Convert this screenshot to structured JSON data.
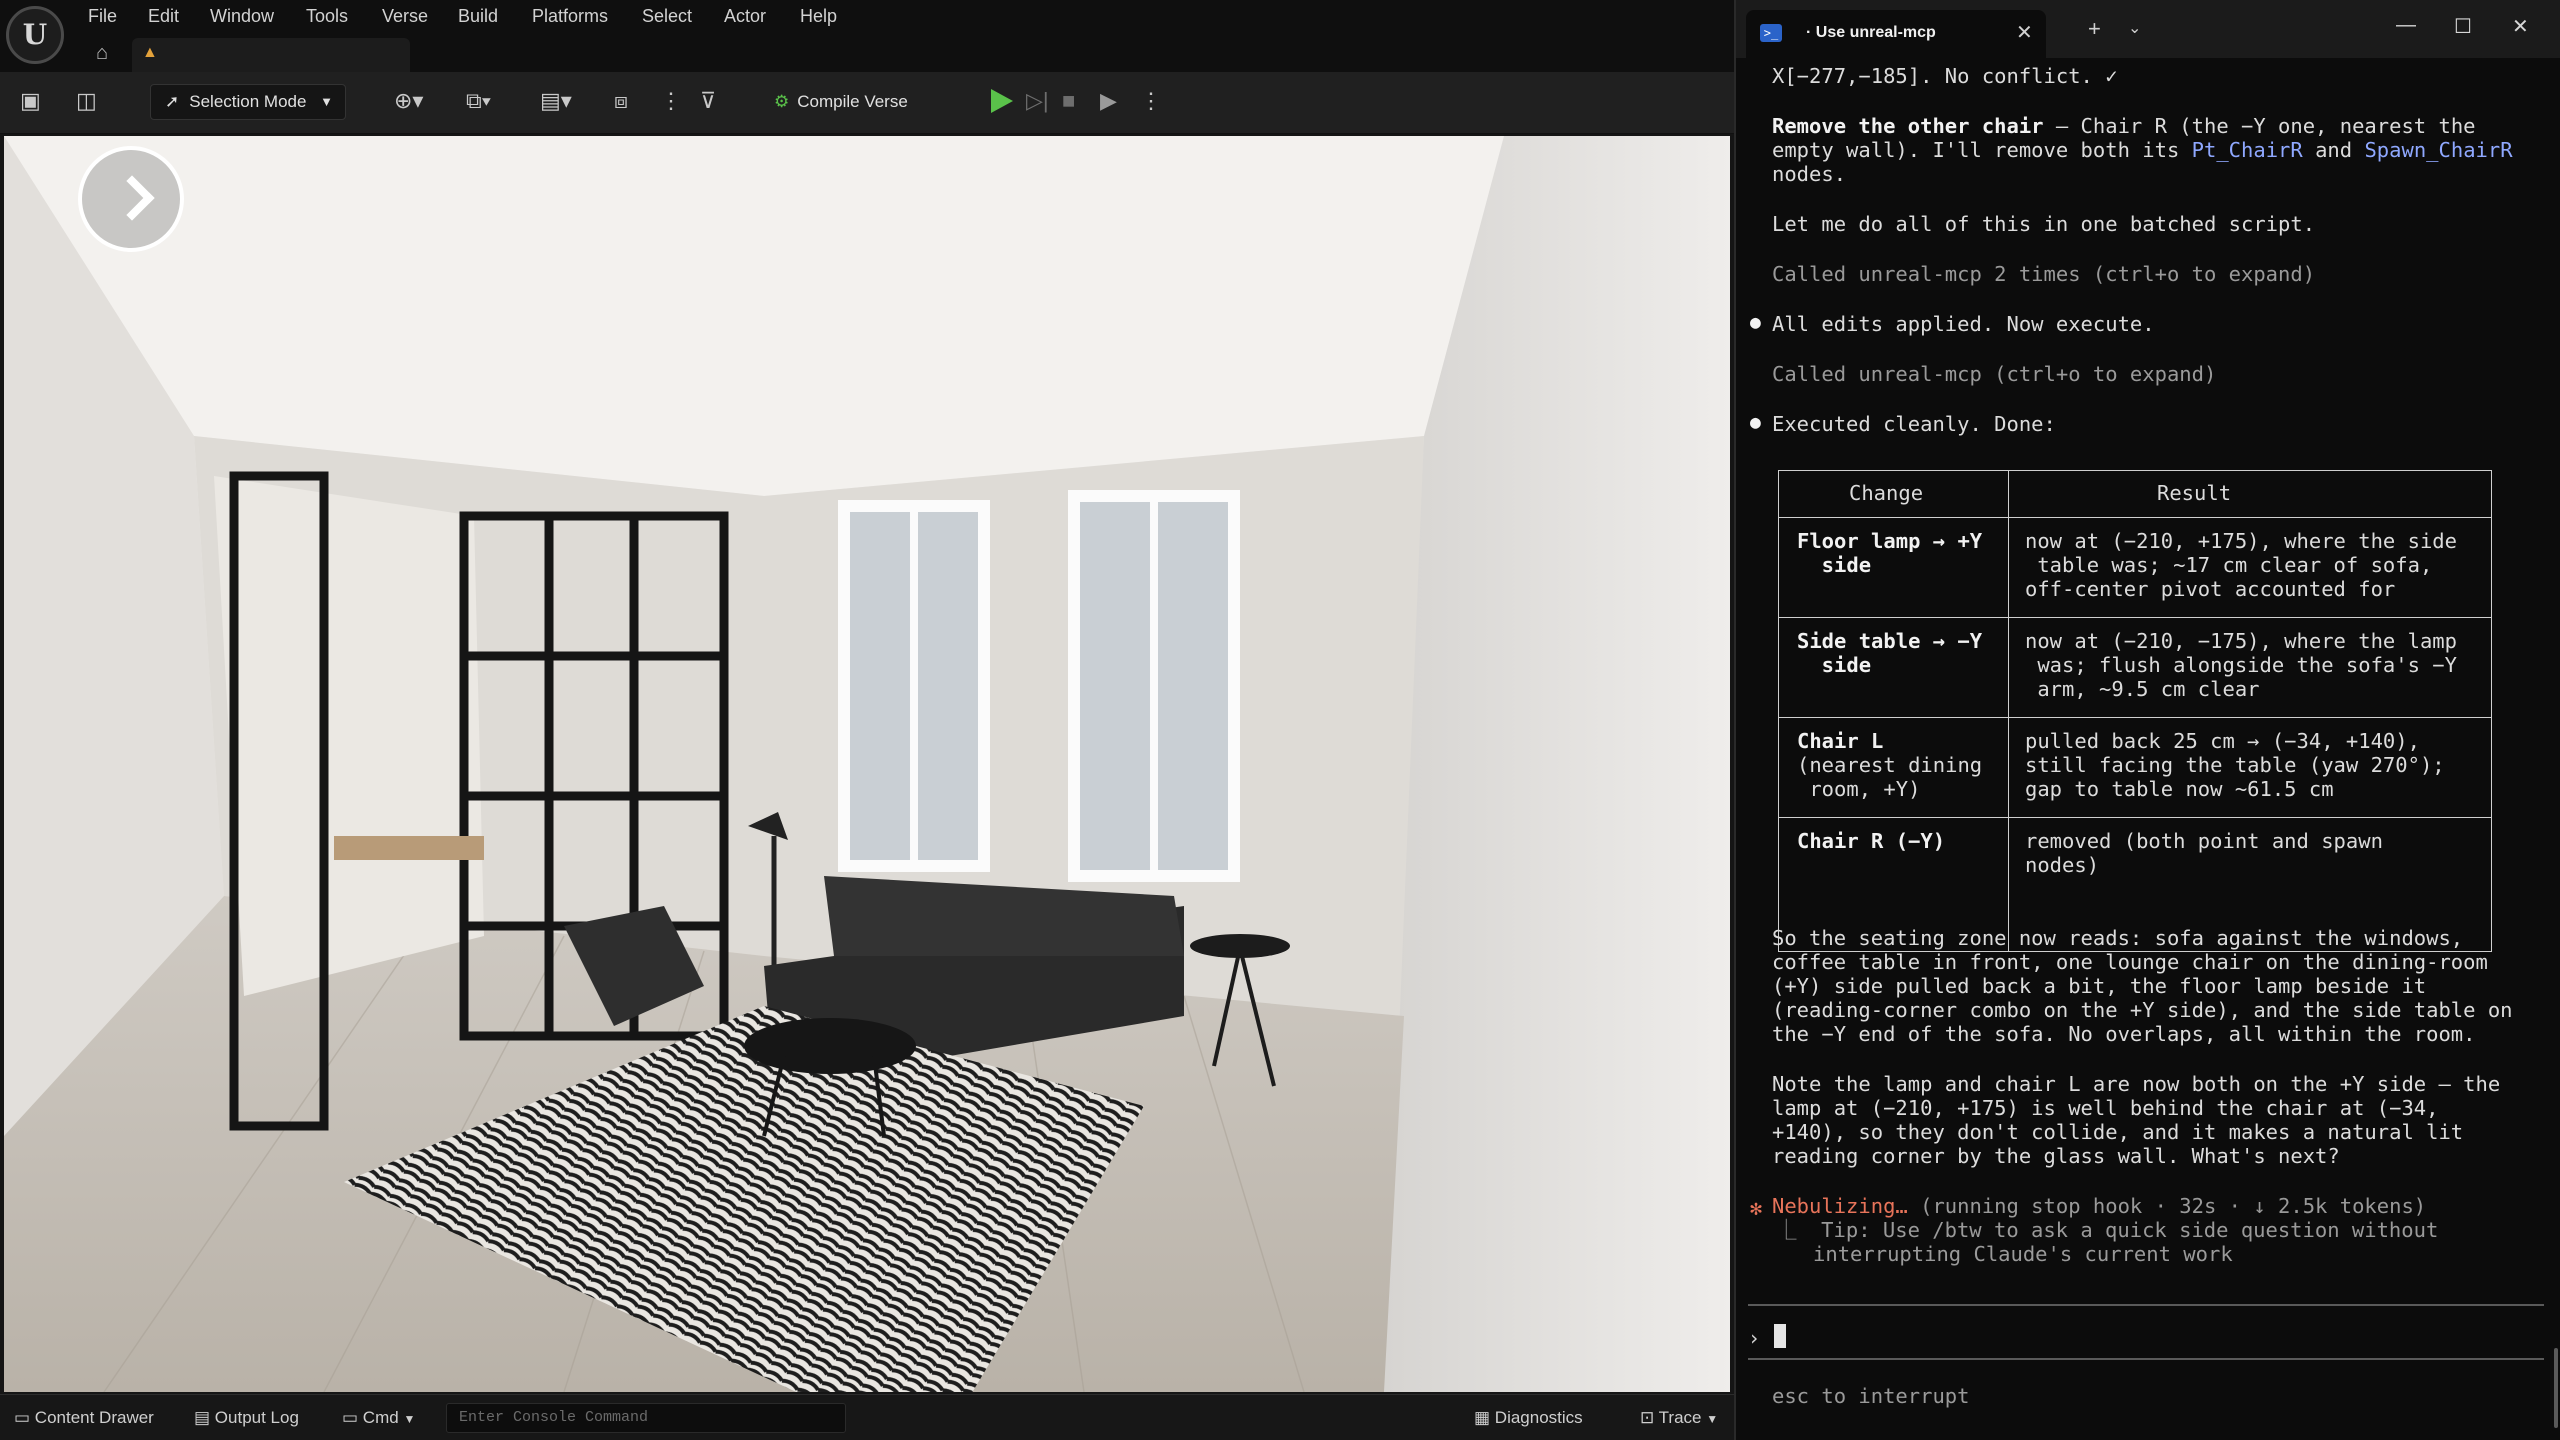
{
  "editor": {
    "menu": [
      "File",
      "Edit",
      "Window",
      "Tools",
      "Verse",
      "Build",
      "Platforms",
      "Select",
      "Actor",
      "Help"
    ],
    "toolbar": {
      "selection_mode": "Selection Mode",
      "compile_verse": "Compile Verse"
    },
    "statusbar": {
      "content_drawer": "Content Drawer",
      "output_log": "Output Log",
      "cmd": "Cmd",
      "console_placeholder": "Enter Console Command",
      "diagnostics": "Diagnostics",
      "trace": "Trace"
    },
    "colors": {
      "accent_green": "#5ac24a",
      "warning_orange": "#e3a23b"
    }
  },
  "terminal": {
    "tab_title": "· Use unreal-mcp",
    "lines": {
      "l1": "X[−277,−185]. No conflict. ✓",
      "l2a": "Remove the other chair",
      "l2b": " — Chair R (the −Y one, nearest the",
      "l3a": "empty wall). I'll remove both its ",
      "l3b": "Pt_ChairR",
      "l3c": " and ",
      "l3d": "Spawn_ChairR",
      "l4": "nodes.",
      "l5": "Let me do all of this in one batched script.",
      "l6": "Called unreal-mcp 2 times (ctrl+o to expand)",
      "l7": "All edits applied. Now execute.",
      "l8": "Called unreal-mcp (ctrl+o to expand)",
      "l9": "Executed cleanly. Done:"
    },
    "table": {
      "headers": [
        "Change",
        "Result"
      ],
      "rows": [
        {
          "change": [
            "Floor lamp → +Y",
            "  side"
          ],
          "result": [
            "now at (−210, +175), where the side",
            " table was; ~17 cm clear of sofa,",
            "off-center pivot accounted for"
          ]
        },
        {
          "change": [
            "Side table → −Y",
            "  side"
          ],
          "result": [
            "now at (−210, −175), where the lamp",
            " was; flush alongside the sofa's −Y",
            " arm, ~9.5 cm clear"
          ]
        },
        {
          "change": [
            "Chair L",
            "(nearest dining",
            " room, +Y)"
          ],
          "result": [
            "pulled back 25 cm → (−34, +140),",
            "still facing the table (yaw 270°);",
            "gap to table now ~61.5 cm"
          ]
        },
        {
          "change": [
            "Chair R (−Y)"
          ],
          "result": [
            "removed (both point and spawn",
            "nodes)"
          ]
        }
      ]
    },
    "summary": [
      "So the seating zone now reads: sofa against the windows,",
      "coffee table in front, one lounge chair on the dining-room",
      "(+Y) side pulled back a bit, the floor lamp beside it",
      "(reading-corner combo on the +Y side), and the side table on",
      "the −Y end of the sofa. No overlaps, all within the room."
    ],
    "note": [
      "Note the lamp and chair L are now both on the +Y side — the",
      "lamp at (−210, +175) is well behind the chair at (−34,",
      "+140), so they don't collide, and it makes a natural lit",
      "reading corner by the glass wall. What's next?"
    ],
    "status": {
      "spinner": "✻",
      "word": "Nebulizing…",
      "detail": " (running stop hook · 32s · ↓ 2.5k tokens)",
      "tip1": "⎿  Tip: Use /btw to ask a quick side question without",
      "tip2": "   interrupting Claude's current work"
    },
    "prompt_symbol": "›",
    "footer": "esc to interrupt",
    "colors": {
      "status_orange": "#e8745a",
      "link_blue": "#8fa8ff"
    }
  }
}
